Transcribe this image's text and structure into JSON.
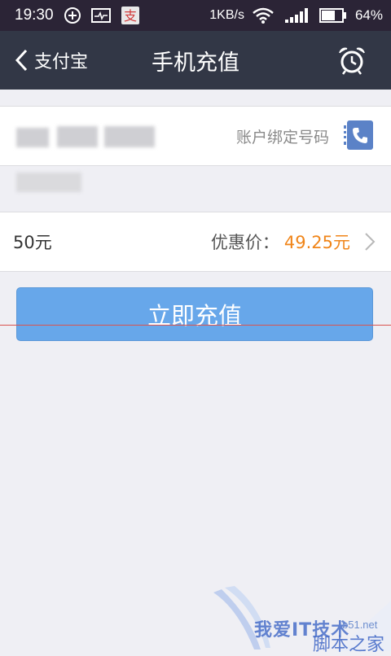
{
  "status_bar": {
    "time": "19:30",
    "network_speed": "1KB/s",
    "battery_percent": "64%",
    "icons": [
      "plus-circle-icon",
      "activity-monitor-icon",
      "alipay-notification-icon",
      "wifi-icon",
      "signal-icon",
      "battery-icon"
    ]
  },
  "nav": {
    "back_label": "支付宝",
    "title": "手机充值",
    "right_icon": "alarm-clock-icon"
  },
  "phone": {
    "number_blurred": true,
    "bound_label": "账户绑定号码",
    "contact_icon": "phone-contact-icon"
  },
  "amount": {
    "value": "50元",
    "discount_label": "优惠价：",
    "discount_price": "49.25元"
  },
  "recharge_button": {
    "label": "立即充值"
  },
  "watermark": {
    "text1": "我爱IT技术",
    "url": "b51.net",
    "text2": "脚本之家"
  },
  "colors": {
    "status_bar_bg": "#2b2436",
    "nav_bg": "#323746",
    "page_bg": "#efeff4",
    "button_bg": "#67a7ea",
    "price_orange": "#f08519",
    "contact_blue": "#5b82c7"
  }
}
